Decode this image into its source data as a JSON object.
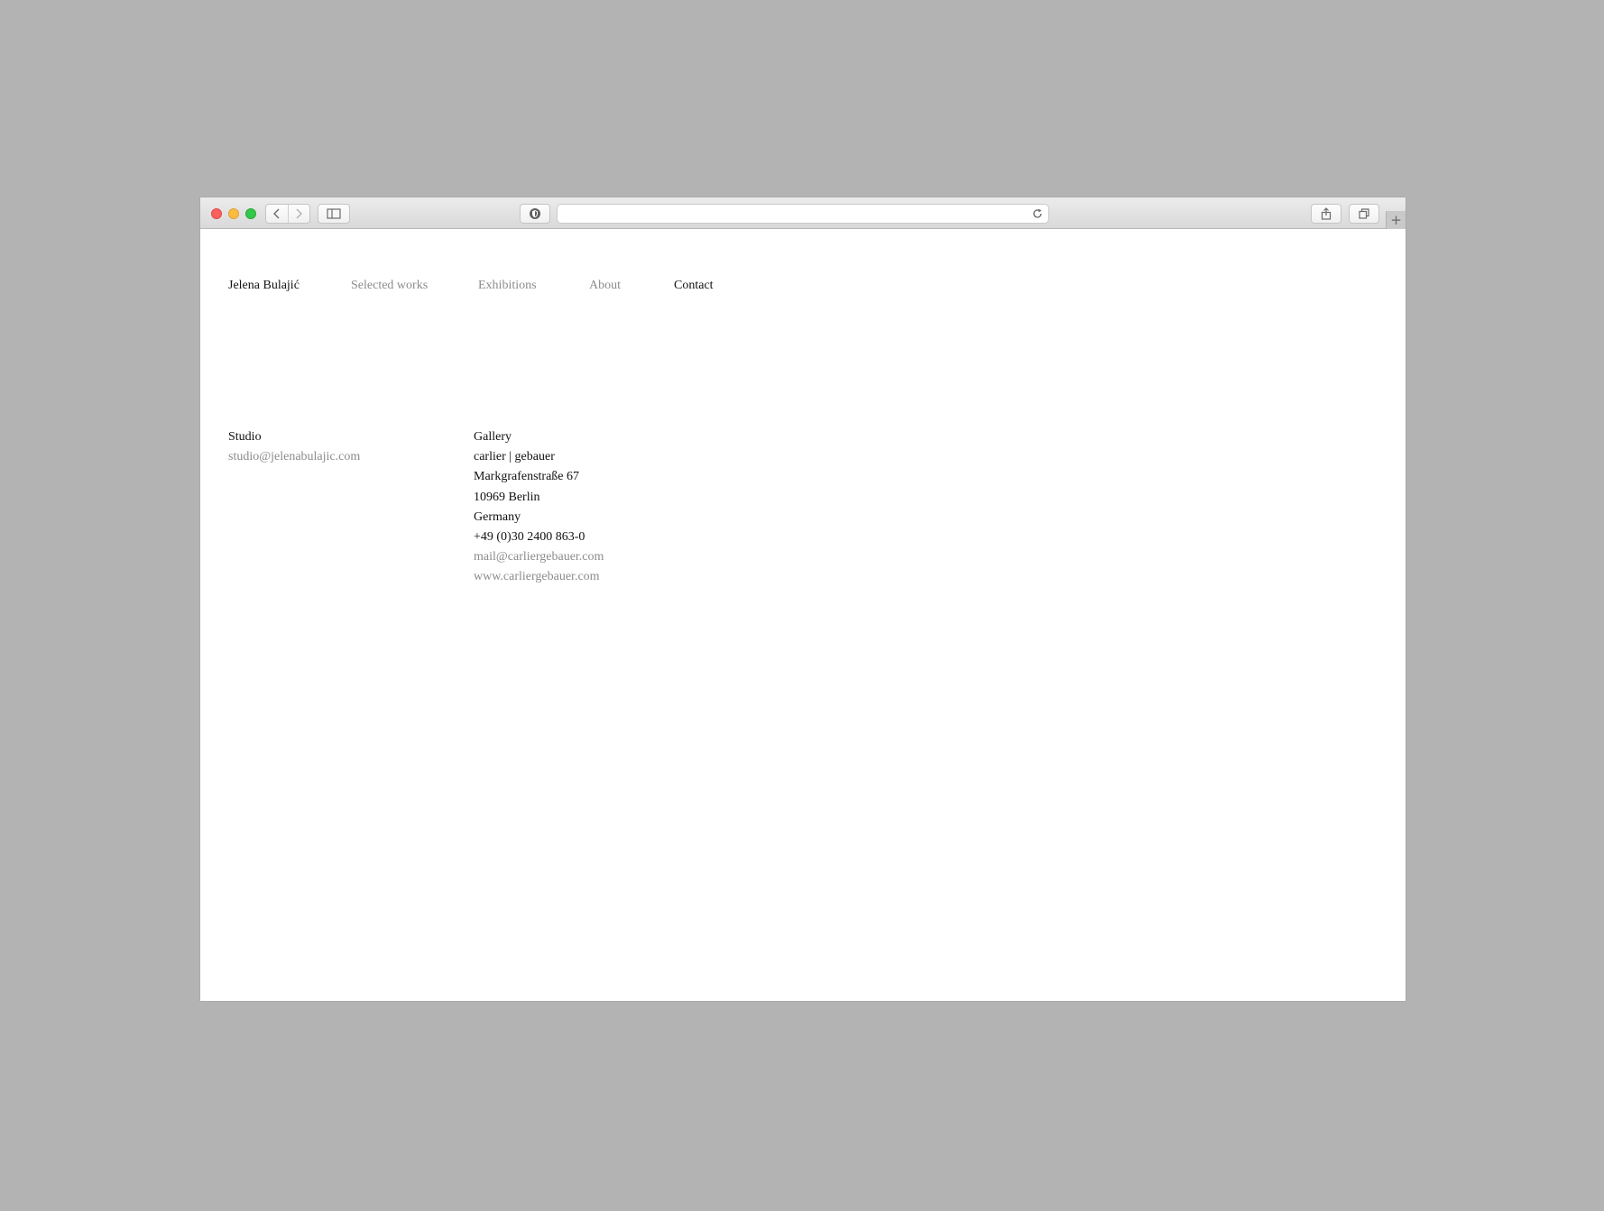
{
  "browser": {
    "url": "",
    "new_tab_symbol": "+"
  },
  "site": {
    "name": "Jelena Bulajić",
    "nav": [
      {
        "label": "Selected works",
        "active": false
      },
      {
        "label": "Exhibitions",
        "active": false
      },
      {
        "label": "About",
        "active": false
      },
      {
        "label": "Contact",
        "active": true
      }
    ]
  },
  "contact": {
    "studio": {
      "heading": "Studio",
      "email": "studio@jelenabulajic.com"
    },
    "gallery": {
      "heading": "Gallery",
      "name": "carlier | gebauer",
      "street": "Markgrafenstraße 67",
      "city": "10969 Berlin",
      "country": "Germany",
      "phone": "+49 (0)30 2400 863-0",
      "email": "mail@carliergebauer.com",
      "website": "www.carliergebauer.com"
    }
  },
  "colors": {
    "backdrop": "#b3b3b3",
    "page_bg": "#ffffff",
    "text_primary": "#111111",
    "text_muted": "#8b8b8b",
    "traffic_close": "#fc605c",
    "traffic_minimize": "#fdbc40",
    "traffic_maximize": "#34c84a"
  },
  "icons": {
    "back": "chevron-left-icon",
    "forward": "chevron-right-icon",
    "sidebar": "sidebar-icon",
    "privacy": "shield-icon",
    "reload": "reload-icon",
    "share": "share-icon",
    "tabs": "tabs-overview-icon",
    "new_tab": "plus-icon"
  }
}
